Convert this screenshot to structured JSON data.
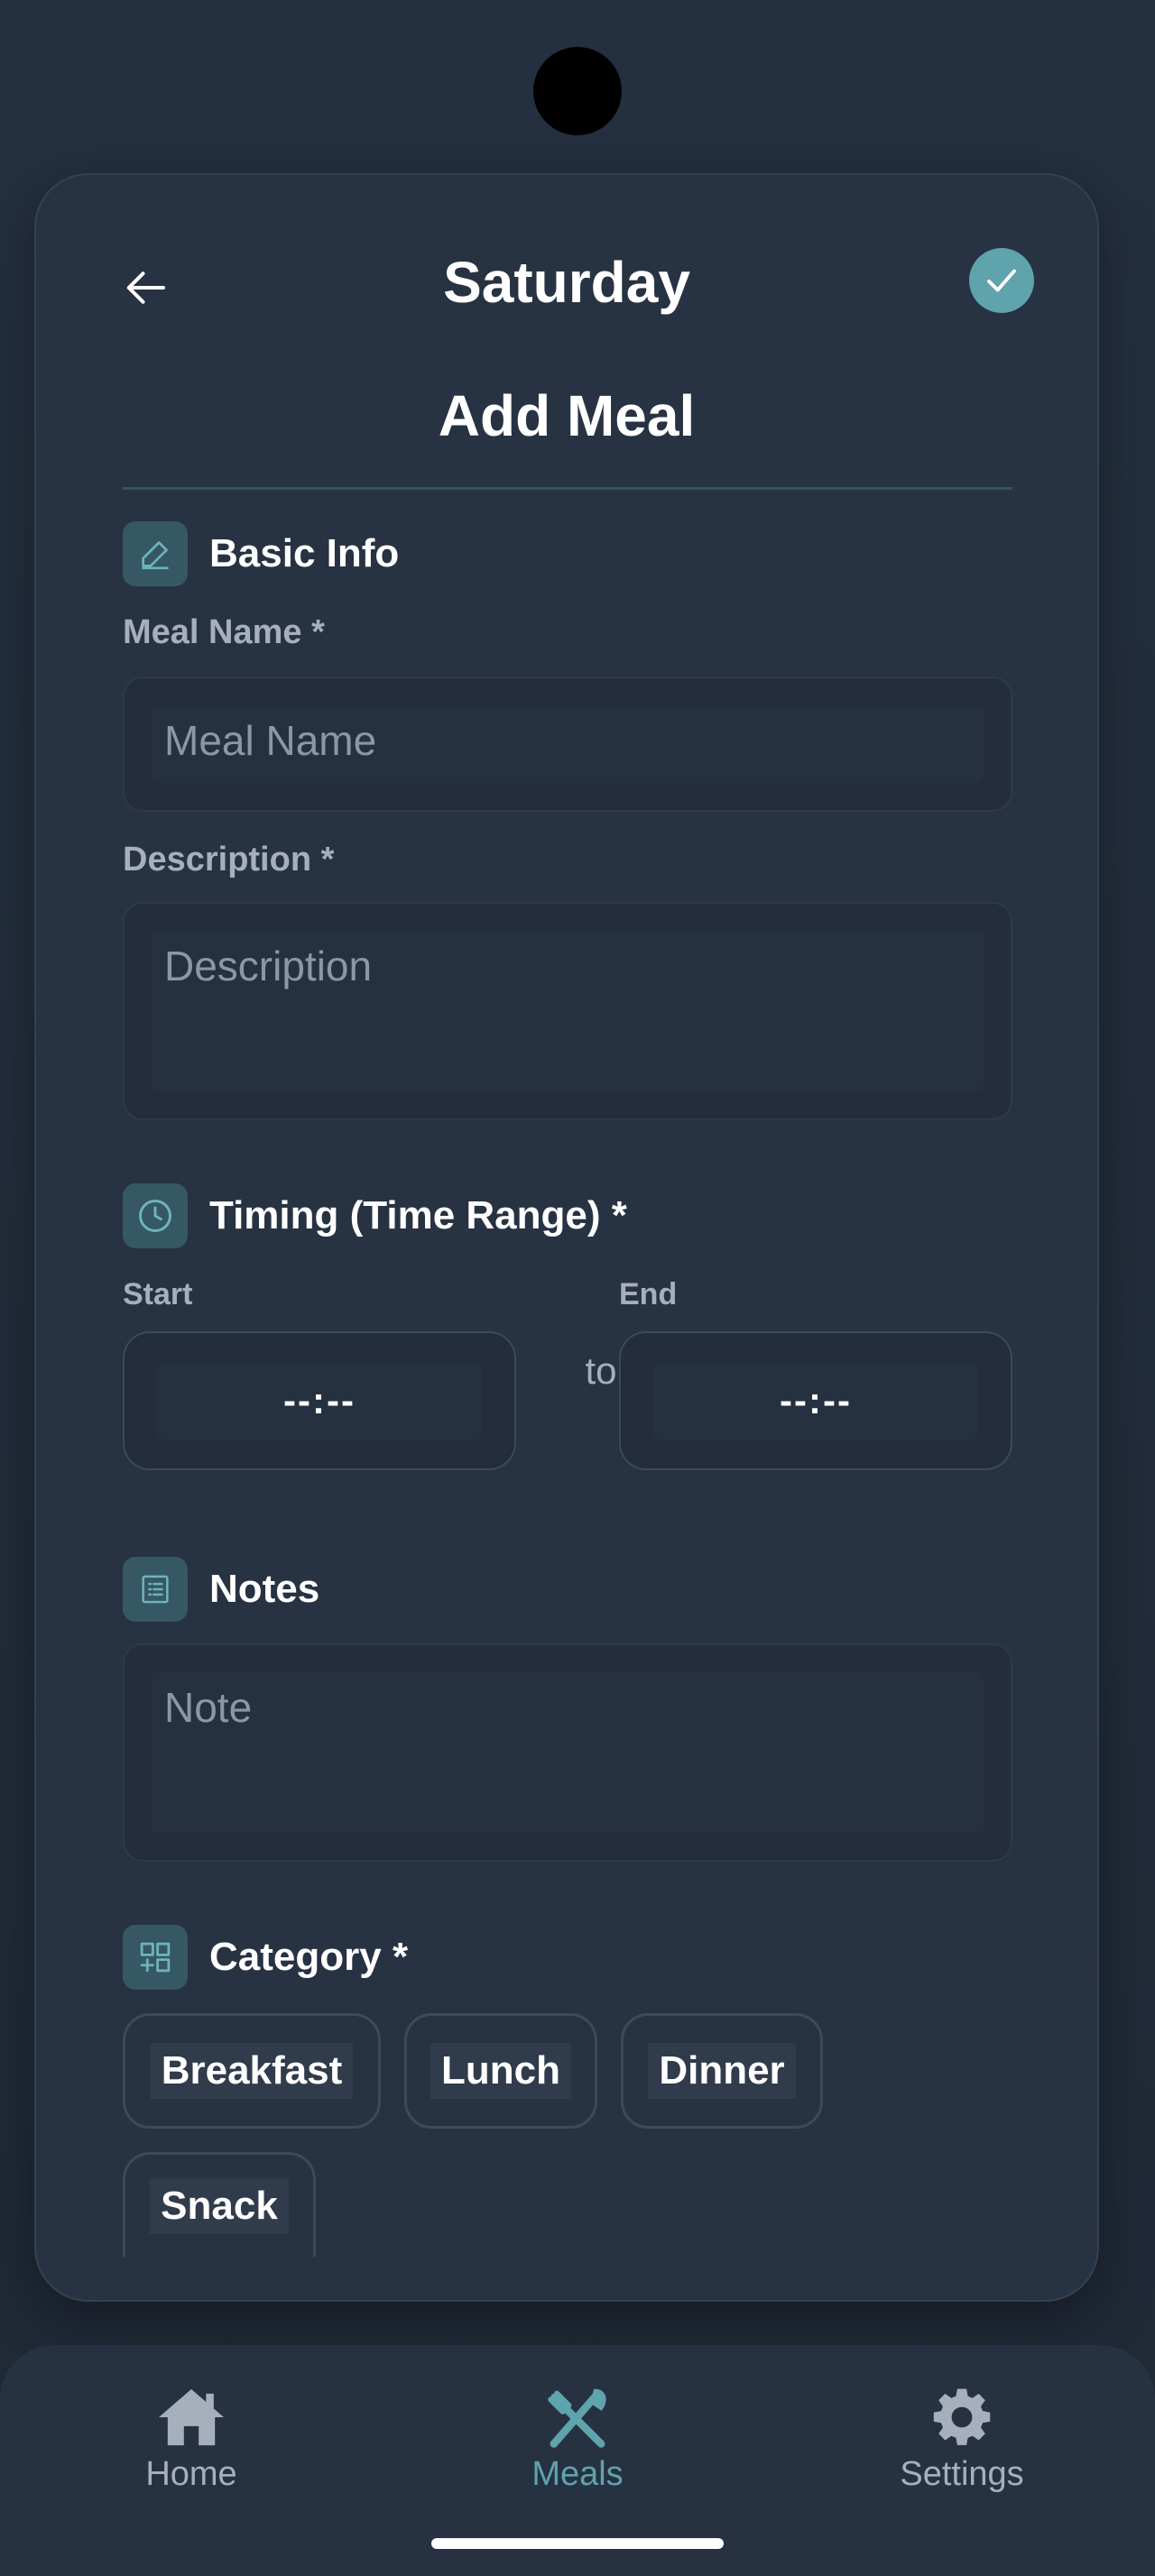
{
  "header": {
    "day_title": "Saturday",
    "page_title": "Add Meal"
  },
  "basic_info": {
    "section_title": "Basic Info",
    "meal_name_label": "Meal Name *",
    "meal_name_placeholder": "Meal Name",
    "description_label": "Description *",
    "description_placeholder": "Description"
  },
  "timing": {
    "section_title": "Timing (Time Range) *",
    "start_label": "Start",
    "end_label": "End",
    "start_value": "--:--",
    "end_value": "--:--",
    "to_label": "to"
  },
  "notes": {
    "section_title": "Notes",
    "note_placeholder": "Note"
  },
  "category": {
    "section_title": "Category *",
    "options": [
      "Breakfast",
      "Lunch",
      "Dinner",
      "Snack"
    ]
  },
  "bottom_nav": {
    "items": [
      {
        "label": "Home",
        "icon": "home-icon"
      },
      {
        "label": "Meals",
        "icon": "utensils-icon"
      },
      {
        "label": "Settings",
        "icon": "gear-icon"
      }
    ],
    "active": "Meals"
  },
  "colors": {
    "accent": "#5fa3ac",
    "background": "#222c3a",
    "card": "#273242"
  }
}
